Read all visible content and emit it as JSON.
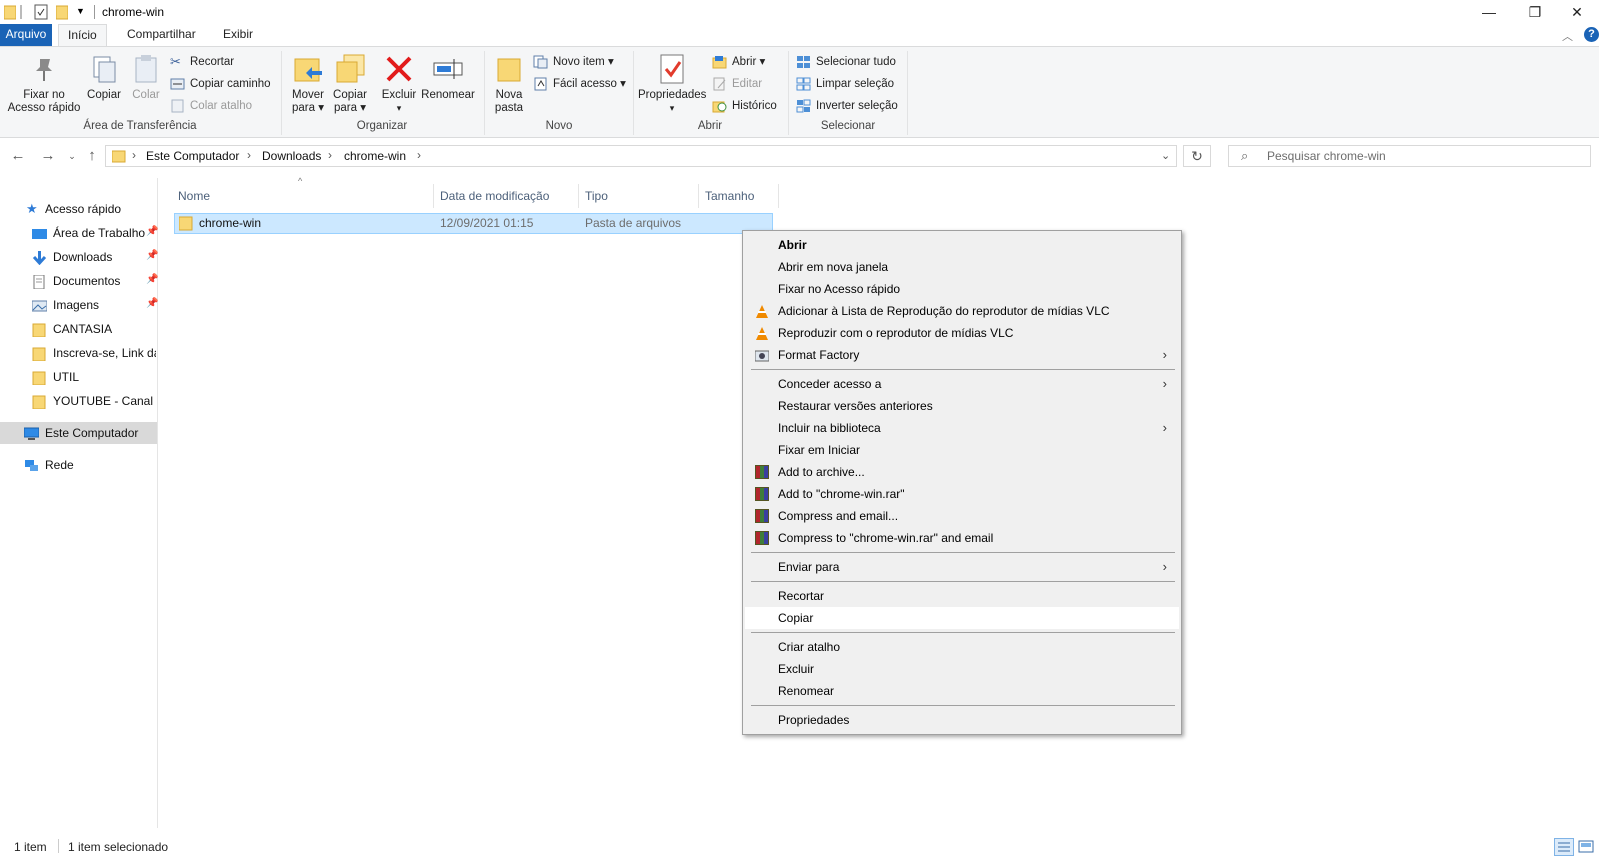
{
  "window": {
    "title": "chrome-win",
    "controls": [
      "—",
      "❐",
      "✕"
    ]
  },
  "ribbon_tabs": [
    "Arquivo",
    "Início",
    "Compartilhar",
    "Exibir"
  ],
  "ribbon": {
    "clipboard": {
      "pin_label_1": "Fixar no",
      "pin_label_2": "Acesso rápido",
      "copy": "Copiar",
      "paste": "Colar",
      "cut": "Recortar",
      "copy_path": "Copiar caminho",
      "paste_shortcut": "Colar atalho",
      "group": "Área de Transferência"
    },
    "organize": {
      "move_1": "Mover",
      "move_2": "para",
      "copyto_1": "Copiar",
      "copyto_2": "para",
      "delete": "Excluir",
      "rename": "Renomear",
      "group": "Organizar"
    },
    "new": {
      "new_folder_1": "Nova",
      "new_folder_2": "pasta",
      "new_item": "Novo item",
      "easy_access": "Fácil acesso",
      "group": "Novo"
    },
    "open": {
      "properties": "Propriedades",
      "open": "Abrir",
      "edit": "Editar",
      "history": "Histórico",
      "group": "Abrir"
    },
    "select": {
      "select_all": "Selecionar tudo",
      "select_none": "Limpar seleção",
      "invert": "Inverter seleção",
      "group": "Selecionar"
    }
  },
  "address": {
    "crumbs": [
      "Este Computador",
      "Downloads",
      "chrome-win"
    ],
    "search_placeholder": "Pesquisar chrome-win"
  },
  "nav_pane": {
    "quick_access": "Acesso rápido",
    "items": [
      "Área de Trabalho",
      "Downloads",
      "Documentos",
      "Imagens",
      "CANTASIA",
      "Inscreva-se, Link da",
      "UTIL",
      "YOUTUBE - Canal d"
    ],
    "this_pc": "Este Computador",
    "network": "Rede"
  },
  "columns": [
    "Nome",
    "Data de modificação",
    "Tipo",
    "Tamanho"
  ],
  "files": [
    {
      "name": "chrome-win",
      "modified": "12/09/2021 01:15",
      "type": "Pasta de arquivos",
      "size": ""
    }
  ],
  "context_menu": {
    "items": [
      "Abrir",
      "Abrir em nova janela",
      "Fixar no Acesso rápido",
      "Adicionar à Lista de Reprodução do reprodutor de mídias VLC",
      "Reproduzir com o reprodutor de mídias VLC",
      "Format Factory",
      "Conceder acesso a",
      "Restaurar versões anteriores",
      "Incluir na biblioteca",
      "Fixar em Iniciar",
      "Add to archive...",
      "Add to \"chrome-win.rar\"",
      "Compress and email...",
      "Compress to \"chrome-win.rar\" and email",
      "Enviar para",
      "Recortar",
      "Copiar",
      "Criar atalho",
      "Excluir",
      "Renomear",
      "Propriedades"
    ],
    "hovered": "Copiar"
  },
  "status": {
    "count": "1 item",
    "selected": "1 item selecionado"
  },
  "colors": {
    "accent": "#1a63b6",
    "selection": "#cce8ff",
    "folder": "#f8d775"
  }
}
